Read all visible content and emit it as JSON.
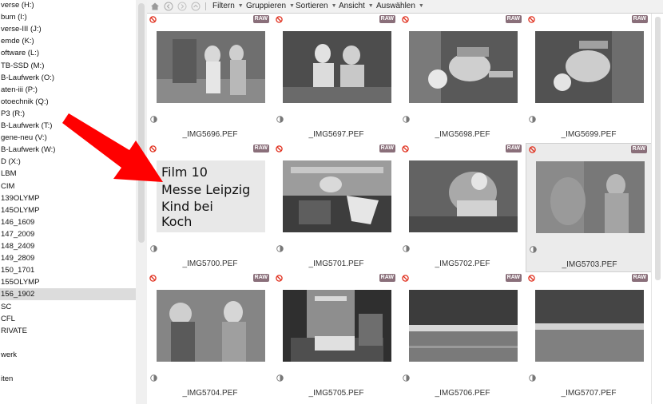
{
  "sidebar": {
    "items": [
      {
        "label": "verse (H:)"
      },
      {
        "label": "bum (I:)"
      },
      {
        "label": "verse-III (J:)"
      },
      {
        "label": "emde (K:)"
      },
      {
        "label": "oftware (L:)"
      },
      {
        "label": "TB-SSD (M:)"
      },
      {
        "label": "B-Laufwerk (O:)"
      },
      {
        "label": "aten-iii (P:)"
      },
      {
        "label": "otoechnik (Q:)"
      },
      {
        "label": "P3 (R:)"
      },
      {
        "label": "B-Laufwerk (T:)"
      },
      {
        "label": "gene-neu (V:)"
      },
      {
        "label": "B-Laufwerk (W:)"
      },
      {
        "label": "D (X:)"
      },
      {
        "label": "LBM"
      },
      {
        "label": "CIM"
      },
      {
        "label": "139OLYMP"
      },
      {
        "label": "145OLYMP"
      },
      {
        "label": "146_1609"
      },
      {
        "label": "147_2009"
      },
      {
        "label": "148_2409"
      },
      {
        "label": "149_2809"
      },
      {
        "label": "150_1701"
      },
      {
        "label": "155OLYMP"
      },
      {
        "label": "156_1902",
        "selected": true
      },
      {
        "label": "SC"
      },
      {
        "label": "CFL"
      },
      {
        "label": "RIVATE"
      },
      {
        "label": ""
      },
      {
        "label": "werk"
      },
      {
        "label": ""
      },
      {
        "label": "iten"
      }
    ]
  },
  "toolbar": {
    "menus": [
      {
        "label": "Filtern"
      },
      {
        "label": "Gruppieren"
      },
      {
        "label": "Sortieren"
      },
      {
        "label": "Ansicht"
      },
      {
        "label": "Auswählen"
      }
    ]
  },
  "thumbnails": [
    {
      "filename": "_IMG5696.PEF",
      "badge": "RAW",
      "selected": false
    },
    {
      "filename": "_IMG5697.PEF",
      "badge": "RAW",
      "selected": false
    },
    {
      "filename": "_IMG5698.PEF",
      "badge": "RAW",
      "selected": false
    },
    {
      "filename": "_IMG5699.PEF",
      "badge": "RAW",
      "selected": false
    },
    {
      "filename": "_IMG5700.PEF",
      "badge": "RAW",
      "selected": false,
      "handwriting": [
        "Film 10",
        "Messe Leipzig",
        "Kind bei",
        "Koch"
      ]
    },
    {
      "filename": "_IMG5701.PEF",
      "badge": "RAW",
      "selected": false
    },
    {
      "filename": "_IMG5702.PEF",
      "badge": "RAW",
      "selected": false
    },
    {
      "filename": "_IMG5703.PEF",
      "badge": "RAW",
      "selected": true
    },
    {
      "filename": "_IMG5704.PEF",
      "badge": "RAW",
      "selected": false
    },
    {
      "filename": "_IMG5705.PEF",
      "badge": "RAW",
      "selected": false
    },
    {
      "filename": "_IMG5706.PEF",
      "badge": "RAW",
      "selected": false
    },
    {
      "filename": "_IMG5707.PEF",
      "badge": "RAW",
      "selected": false
    }
  ],
  "icons": {
    "nav": [
      "home-icon",
      "back-icon",
      "forward-icon",
      "up-icon"
    ],
    "flag": "reject-flag-icon",
    "status": "half-circle-icon"
  },
  "colors": {
    "arrow": "#ff0000",
    "raw_badge": "#8a6f7a",
    "reject_flag": "#e0301e",
    "selected_cell": "#ebebeb"
  }
}
